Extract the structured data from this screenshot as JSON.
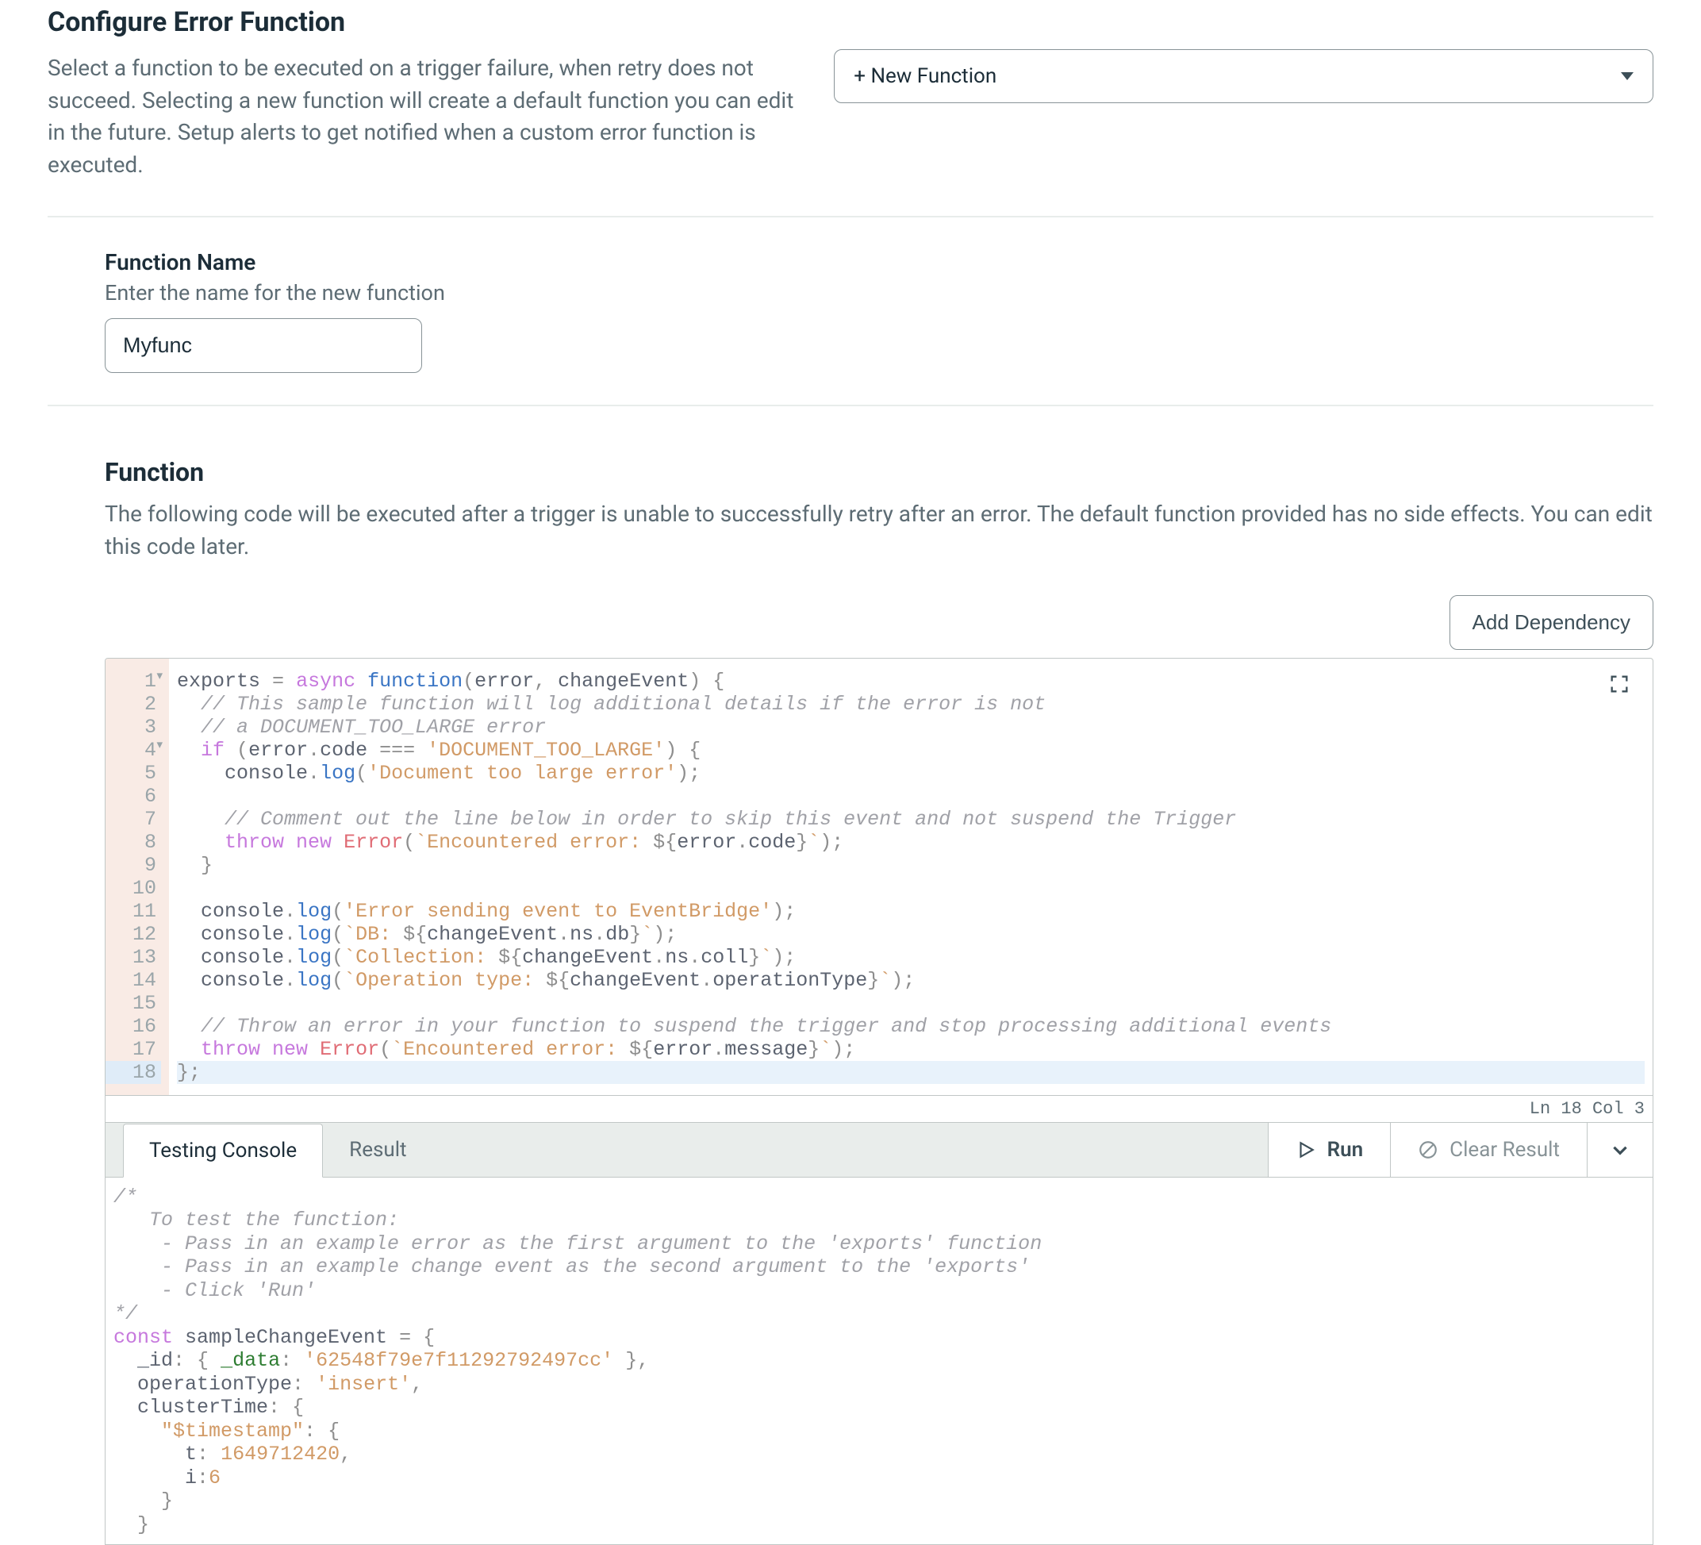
{
  "header": {
    "title": "Configure Error Function",
    "description": "Select a function to be executed on a trigger failure, when retry does not succeed. Selecting a new function will create a default function you can edit in the future. Setup alerts to get notified when a custom error function is executed."
  },
  "dropdown": {
    "label": "+ New Function"
  },
  "function_name": {
    "label": "Function Name",
    "hint": "Enter the name for the new function",
    "value": "Myfunc"
  },
  "function_section": {
    "title": "Function",
    "description": "The following code will be executed after a trigger is unable to successfully retry after an error. The default function provided has no side effects. You can edit this code later.",
    "add_dependency_label": "Add Dependency"
  },
  "editor": {
    "lines": 18,
    "status": "Ln 18 Col 3",
    "tokens": [
      [
        [
          "plain",
          "exports "
        ],
        [
          "op",
          "="
        ],
        [
          "plain",
          " "
        ],
        [
          "kw",
          "async"
        ],
        [
          "plain",
          " "
        ],
        [
          "fn",
          "function"
        ],
        [
          "op",
          "("
        ],
        [
          "plain",
          "error"
        ],
        [
          "op",
          ","
        ],
        [
          "plain",
          " changeEvent"
        ],
        [
          "op",
          ")"
        ],
        [
          "plain",
          " "
        ],
        [
          "op",
          "{"
        ]
      ],
      [
        [
          "plain",
          "  "
        ],
        [
          "comm",
          "// This sample function will log additional details if the error is not"
        ]
      ],
      [
        [
          "plain",
          "  "
        ],
        [
          "comm",
          "// a DOCUMENT_TOO_LARGE error"
        ]
      ],
      [
        [
          "plain",
          "  "
        ],
        [
          "kw",
          "if"
        ],
        [
          "plain",
          " "
        ],
        [
          "op",
          "("
        ],
        [
          "plain",
          "error"
        ],
        [
          "op",
          "."
        ],
        [
          "plain",
          "code "
        ],
        [
          "op",
          "==="
        ],
        [
          "plain",
          " "
        ],
        [
          "str",
          "'DOCUMENT_TOO_LARGE'"
        ],
        [
          "op",
          ")"
        ],
        [
          "plain",
          " "
        ],
        [
          "op",
          "{"
        ]
      ],
      [
        [
          "plain",
          "    "
        ],
        [
          "plain",
          "console"
        ],
        [
          "op",
          "."
        ],
        [
          "fn",
          "log"
        ],
        [
          "op",
          "("
        ],
        [
          "str",
          "'Document too large error'"
        ],
        [
          "op",
          ");"
        ]
      ],
      [
        [
          "plain",
          ""
        ]
      ],
      [
        [
          "plain",
          "    "
        ],
        [
          "comm",
          "// Comment out the line below in order to skip this event and not suspend the Trigger"
        ]
      ],
      [
        [
          "plain",
          "    "
        ],
        [
          "kw",
          "throw"
        ],
        [
          "plain",
          " "
        ],
        [
          "kw",
          "new"
        ],
        [
          "plain",
          " "
        ],
        [
          "err",
          "Error"
        ],
        [
          "op",
          "("
        ],
        [
          "str",
          "`Encountered error: "
        ],
        [
          "op",
          "${"
        ],
        [
          "plain",
          "error"
        ],
        [
          "op",
          "."
        ],
        [
          "plain",
          "code"
        ],
        [
          "op",
          "}"
        ],
        [
          "str",
          "`"
        ],
        [
          "op",
          ");"
        ]
      ],
      [
        [
          "plain",
          "  "
        ],
        [
          "op",
          "}"
        ]
      ],
      [
        [
          "plain",
          ""
        ]
      ],
      [
        [
          "plain",
          "  "
        ],
        [
          "plain",
          "console"
        ],
        [
          "op",
          "."
        ],
        [
          "fn",
          "log"
        ],
        [
          "op",
          "("
        ],
        [
          "str",
          "'Error sending event to EventBridge'"
        ],
        [
          "op",
          ");"
        ]
      ],
      [
        [
          "plain",
          "  "
        ],
        [
          "plain",
          "console"
        ],
        [
          "op",
          "."
        ],
        [
          "fn",
          "log"
        ],
        [
          "op",
          "("
        ],
        [
          "str",
          "`DB: "
        ],
        [
          "op",
          "${"
        ],
        [
          "plain",
          "changeEvent"
        ],
        [
          "op",
          "."
        ],
        [
          "plain",
          "ns"
        ],
        [
          "op",
          "."
        ],
        [
          "plain",
          "db"
        ],
        [
          "op",
          "}"
        ],
        [
          "str",
          "`"
        ],
        [
          "op",
          ");"
        ]
      ],
      [
        [
          "plain",
          "  "
        ],
        [
          "plain",
          "console"
        ],
        [
          "op",
          "."
        ],
        [
          "fn",
          "log"
        ],
        [
          "op",
          "("
        ],
        [
          "str",
          "`Collection: "
        ],
        [
          "op",
          "${"
        ],
        [
          "plain",
          "changeEvent"
        ],
        [
          "op",
          "."
        ],
        [
          "plain",
          "ns"
        ],
        [
          "op",
          "."
        ],
        [
          "plain",
          "coll"
        ],
        [
          "op",
          "}"
        ],
        [
          "str",
          "`"
        ],
        [
          "op",
          ");"
        ]
      ],
      [
        [
          "plain",
          "  "
        ],
        [
          "plain",
          "console"
        ],
        [
          "op",
          "."
        ],
        [
          "fn",
          "log"
        ],
        [
          "op",
          "("
        ],
        [
          "str",
          "`Operation type: "
        ],
        [
          "op",
          "${"
        ],
        [
          "plain",
          "changeEvent"
        ],
        [
          "op",
          "."
        ],
        [
          "plain",
          "operationType"
        ],
        [
          "op",
          "}"
        ],
        [
          "str",
          "`"
        ],
        [
          "op",
          ");"
        ]
      ],
      [
        [
          "plain",
          ""
        ]
      ],
      [
        [
          "plain",
          "  "
        ],
        [
          "comm",
          "// Throw an error in your function to suspend the trigger and stop processing additional events"
        ]
      ],
      [
        [
          "plain",
          "  "
        ],
        [
          "kw",
          "throw"
        ],
        [
          "plain",
          " "
        ],
        [
          "kw",
          "new"
        ],
        [
          "plain",
          " "
        ],
        [
          "err",
          "Error"
        ],
        [
          "op",
          "("
        ],
        [
          "str",
          "`Encountered error: "
        ],
        [
          "op",
          "${"
        ],
        [
          "plain",
          "error"
        ],
        [
          "op",
          "."
        ],
        [
          "plain",
          "message"
        ],
        [
          "op",
          "}"
        ],
        [
          "str",
          "`"
        ],
        [
          "op",
          ");"
        ]
      ],
      [
        [
          "op",
          "};"
        ]
      ]
    ]
  },
  "console": {
    "tabs": {
      "testing": "Testing Console",
      "result": "Result"
    },
    "run_label": "Run",
    "clear_label": "Clear Result",
    "body_tokens": [
      [
        [
          "comm",
          "/*"
        ]
      ],
      [
        [
          "comm",
          "   To test the function:"
        ]
      ],
      [
        [
          "comm",
          "    - Pass in an example error as the first argument to the 'exports' function"
        ]
      ],
      [
        [
          "comm",
          "    - Pass in an example change event as the second argument to the 'exports'"
        ]
      ],
      [
        [
          "comm",
          "    - Click 'Run'"
        ]
      ],
      [
        [
          "comm",
          "*/"
        ]
      ],
      [
        [
          "kw",
          "const"
        ],
        [
          "plain",
          " sampleChangeEvent "
        ],
        [
          "op",
          "="
        ],
        [
          "plain",
          " "
        ],
        [
          "op",
          "{"
        ]
      ],
      [
        [
          "plain",
          "  _id"
        ],
        [
          "op",
          ":"
        ],
        [
          "plain",
          " "
        ],
        [
          "op",
          "{"
        ],
        [
          "plain",
          " "
        ],
        [
          "prop",
          "_data"
        ],
        [
          "op",
          ":"
        ],
        [
          "plain",
          " "
        ],
        [
          "str",
          "'62548f79e7f11292792497cc'"
        ],
        [
          "plain",
          " "
        ],
        [
          "op",
          "},"
        ]
      ],
      [
        [
          "plain",
          "  operationType"
        ],
        [
          "op",
          ":"
        ],
        [
          "plain",
          " "
        ],
        [
          "str",
          "'insert'"
        ],
        [
          "op",
          ","
        ]
      ],
      [
        [
          "plain",
          "  clusterTime"
        ],
        [
          "op",
          ":"
        ],
        [
          "plain",
          " "
        ],
        [
          "op",
          "{"
        ]
      ],
      [
        [
          "plain",
          "    "
        ],
        [
          "str",
          "\"$timestamp\""
        ],
        [
          "op",
          ":"
        ],
        [
          "plain",
          " "
        ],
        [
          "op",
          "{"
        ]
      ],
      [
        [
          "plain",
          "      t"
        ],
        [
          "op",
          ":"
        ],
        [
          "plain",
          " "
        ],
        [
          "num",
          "1649712420"
        ],
        [
          "op",
          ","
        ]
      ],
      [
        [
          "plain",
          "      i"
        ],
        [
          "op",
          ":"
        ],
        [
          "num",
          "6"
        ]
      ],
      [
        [
          "plain",
          "    "
        ],
        [
          "op",
          "}"
        ]
      ],
      [
        [
          "plain",
          "  "
        ],
        [
          "op",
          "}"
        ]
      ]
    ]
  }
}
